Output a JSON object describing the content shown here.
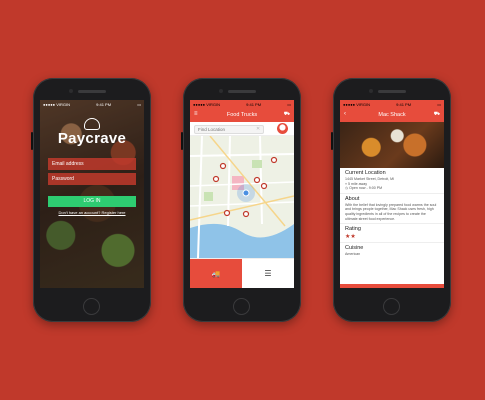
{
  "login": {
    "status_left": "●●●●● VIRGIN",
    "status_time": "9:41 PM",
    "brand": "Paycrave",
    "email_placeholder": "Email address",
    "password_placeholder": "Password",
    "login_label": "LOG IN",
    "signup_text": "Don't have an account? Register here"
  },
  "map": {
    "status_left": "●●●●● VIRGIN",
    "status_time": "9:41 PM",
    "title": "Food Trucks",
    "search_placeholder": "Find Location",
    "menu_icon": "hamburger-icon",
    "truck_icon": "truck-icon",
    "tab_map_label": "🚚",
    "tab_list_label": "☰"
  },
  "detail": {
    "status_left": "●●●●● VIRGIN",
    "status_time": "9:41 PM",
    "title": "Mac Shack",
    "location_title": "Current Location",
    "address": "1445 Market Street, Detroit, MI",
    "distance": "5 mile away",
    "hours": "Open now - 9:00 PM",
    "about_title": "About",
    "about_text": "With the belief that lovingly prepared food warms the soul and brings people together, Mac Shack uses fresh, high quality ingredients in all of the recipes to create the ultimate street food experience.",
    "rating_title": "Rating",
    "rating_stars": "★★",
    "cuisine_title": "Cuisine",
    "cuisine_value": "American"
  },
  "colors": {
    "background": "#c0392b",
    "accent": "#e74c3c",
    "button_green": "#2ecc71"
  }
}
